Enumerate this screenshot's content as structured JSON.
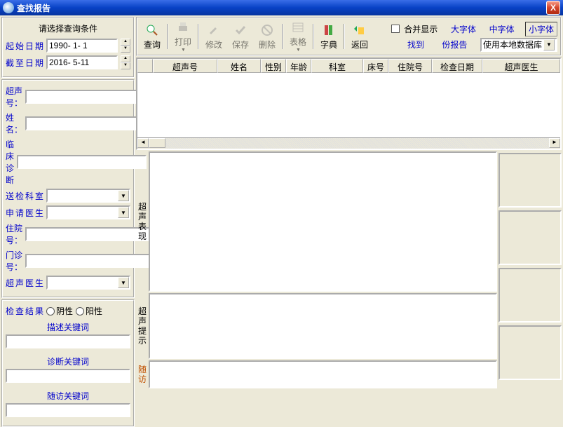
{
  "titlebar": {
    "title": "查找报告",
    "close": "X"
  },
  "sidebar": {
    "panel1_title": "请选择查询条件",
    "start_label": "起始日期",
    "start_val": "1990- 1- 1",
    "end_label": "截至日期",
    "end_val": "2016- 5-11",
    "us_no": "超声号：",
    "name": "姓 名：",
    "diag": "临床诊断",
    "dept": "送检科室",
    "req_doc": "申请医生",
    "inpat": "住院号：",
    "outpat": "门诊号：",
    "us_doc": "超声医生",
    "result_label": "检查结果",
    "neg": "阴性",
    "pos": "阳性",
    "kw1": "描述关键词",
    "kw2": "诊断关键词",
    "kw3": "随访关键词"
  },
  "toolbar": {
    "btns": [
      "查询",
      "打印",
      "修改",
      "保存",
      "删除",
      "表格",
      "字典",
      "返回"
    ],
    "merge": "合并显示",
    "font_l": "大字体",
    "font_m": "中字体",
    "font_s": "小字体",
    "found": "找到",
    "reports": "份报告",
    "db_label": "使用本地数据库"
  },
  "grid": {
    "cols": [
      "",
      "超声号",
      "姓名",
      "性别",
      "年龄",
      "科室",
      "床号",
      "住院号",
      "检查日期",
      "超声医生"
    ]
  },
  "detail": {
    "block1": "超声表现",
    "block2": "超声提示",
    "block3": "随访"
  }
}
